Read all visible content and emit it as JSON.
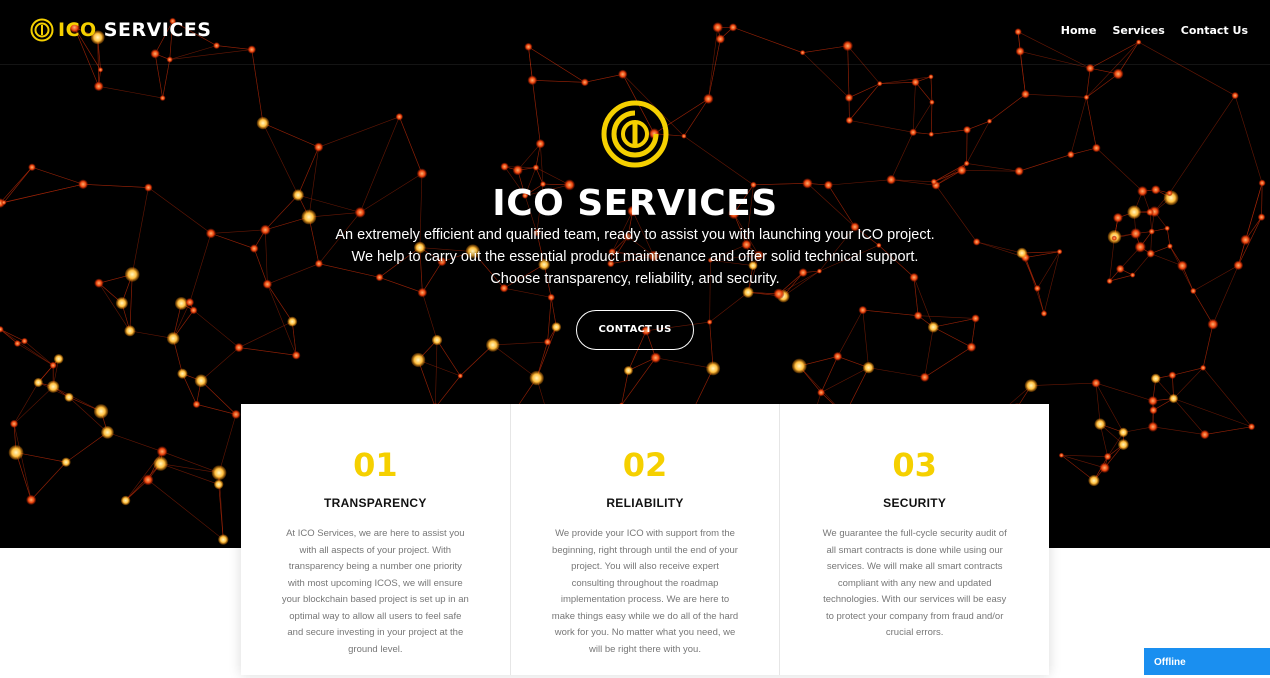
{
  "brand": {
    "prefix": "ICO",
    "suffix": " SERVICES"
  },
  "nav": {
    "items": [
      "Home",
      "Services",
      "Contact Us"
    ]
  },
  "hero": {
    "title": "ICO SERVICES",
    "lines": [
      "An extremely efficient and qualified team, ready to assist you with launching your ICO project.",
      "We help to carry out the essential product maintenance and offer solid technical support.",
      "Choose transparency, reliability, and security."
    ],
    "cta": "CONTACT US"
  },
  "features": [
    {
      "num": "01",
      "title": "TRANSPARENCY",
      "text": "At ICO Services, we are here to assist you with all aspects of your project. With transparency being a number one priority with most upcoming ICOS, we will ensure your blockchain based project is set up in an optimal way to allow all users to feel safe and secure investing in your project at the ground level."
    },
    {
      "num": "02",
      "title": "RELIABILITY",
      "text": "We provide your ICO with support from the beginning, right through until the end of your project. You will also receive expert consulting throughout the roadmap implementation process. We are here to make things easy while we do all of the hard work for you. No matter what you need, we will be right there with you."
    },
    {
      "num": "03",
      "title": "SECURITY",
      "text": "We guarantee the full-cycle security audit of all smart contracts is done while using our services. We will make all smart contracts compliant with any new and updated technologies. With our services will be easy to protect your company from fraud and/or crucial errors."
    }
  ],
  "chat": {
    "status": "Offline"
  },
  "colors": {
    "accent": "#f5d000",
    "hero_bg": "#000000",
    "node_warm": "#ff5a10",
    "node_hot": "#ffc040",
    "chat": "#1a8ff0"
  }
}
